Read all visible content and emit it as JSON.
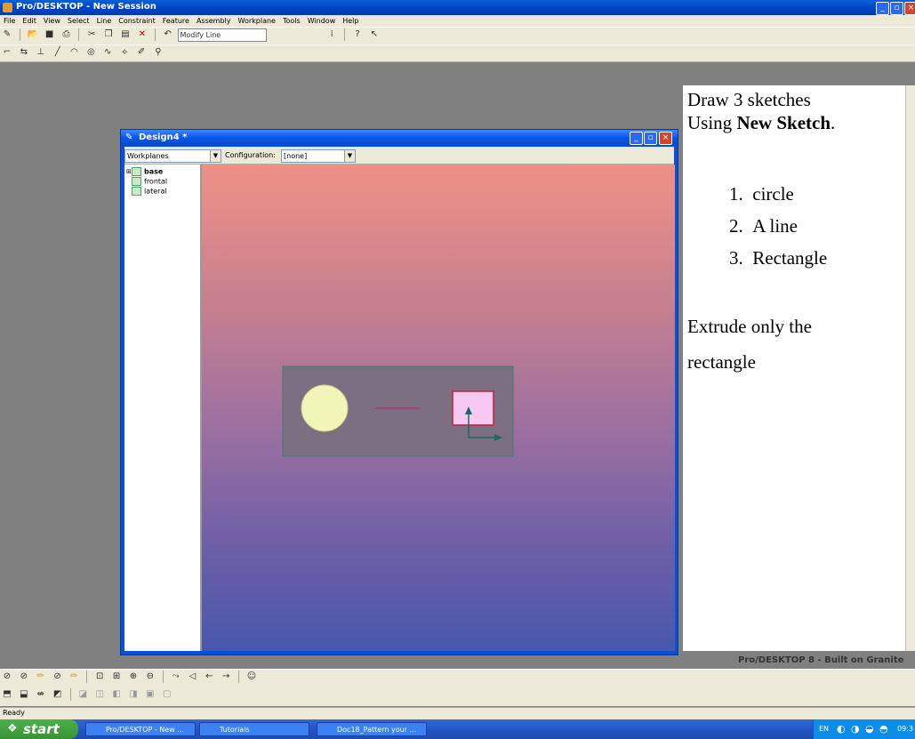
{
  "app": {
    "title": "Pro/DESKTOP - New Session",
    "brand": "Pro/DESKTOP 8 - Built on Granite"
  },
  "menu": [
    "File",
    "Edit",
    "View",
    "Select",
    "Line",
    "Constraint",
    "Feature",
    "Assembly",
    "Workplane",
    "Tools",
    "Window",
    "Help"
  ],
  "toolbar": {
    "combo_value": "Modify Line"
  },
  "design_window": {
    "title": "Design4 *",
    "browser_select": "Workplanes",
    "configuration_label": "Configuration:",
    "configuration_value": "[none]",
    "tree": [
      "base",
      "frontal",
      "lateral"
    ]
  },
  "instructions": {
    "line1": "Draw 3 sketches",
    "line2_prefix": "Using ",
    "line2_bold": "New Sketch",
    "line2_suffix": ".",
    "list": [
      "circle",
      "A line",
      "Rectangle"
    ],
    "extrude_line1": "Extrude only the",
    "extrude_line2": "rectangle"
  },
  "status": "Ready",
  "taskbar": {
    "start": "start",
    "tasks": [
      "Pro/DESKTOP - New ...",
      "Tutorials",
      "Doc18_Pattern your ..."
    ],
    "tray_lang": "EN",
    "clock": "09:3"
  },
  "colors": {
    "circle_fill": "#f2f5b8",
    "rect_fill": "#f6c8f2",
    "rect_border": "#c0203c",
    "axis": "#1c6a5e",
    "line": "#a23a7a"
  }
}
